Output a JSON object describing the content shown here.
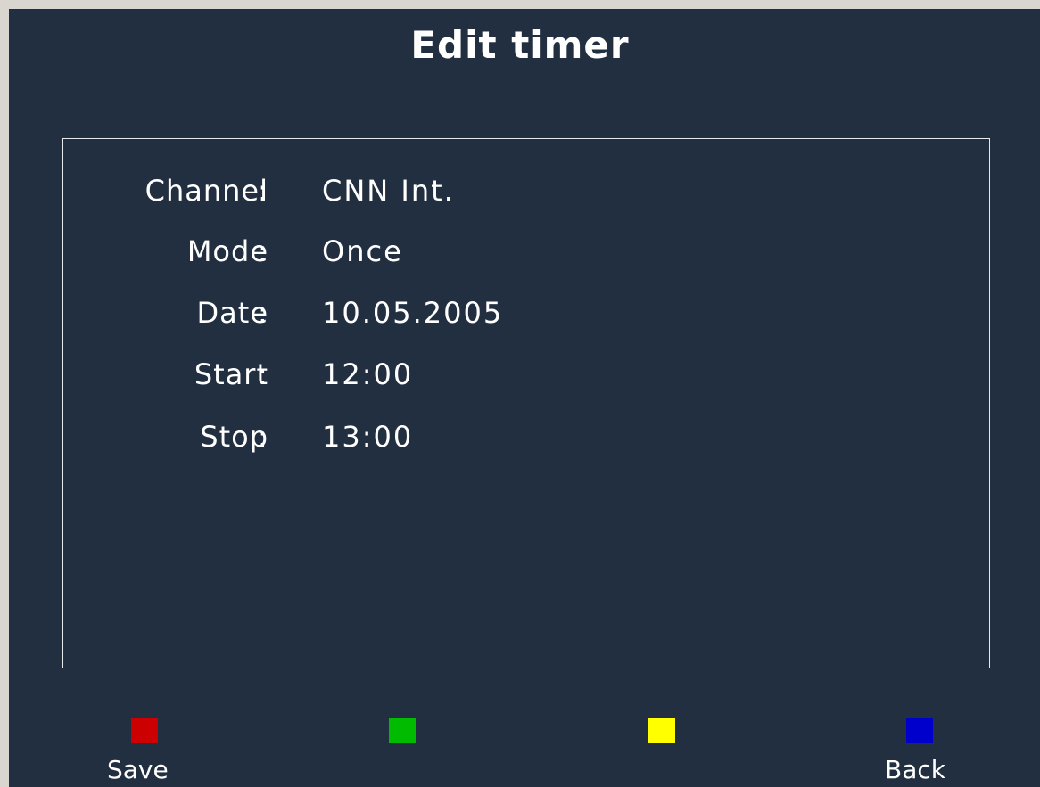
{
  "title": "Edit timer",
  "fields": [
    {
      "label": "Channel",
      "separator": ":",
      "value": "CNN Int."
    },
    {
      "label": "Mode",
      "separator": ":",
      "value": "Once"
    },
    {
      "label": "Date",
      "separator": ":",
      "value": "10.05.2005"
    },
    {
      "label": "Start",
      "separator": ":",
      "value": "12:00"
    },
    {
      "label": "Stop",
      "separator": ":",
      "value": "13:00"
    }
  ],
  "buttons": [
    {
      "color": "#cc0000",
      "label": "Save"
    },
    {
      "color": "#00bb00",
      "label": ""
    },
    {
      "color": "#ffff00",
      "label": ""
    },
    {
      "color": "#0000cc",
      "label": "Back"
    }
  ],
  "colors": {
    "background": "#222f40",
    "text": "#ffffff",
    "panel_border": "#e6e9ee"
  }
}
